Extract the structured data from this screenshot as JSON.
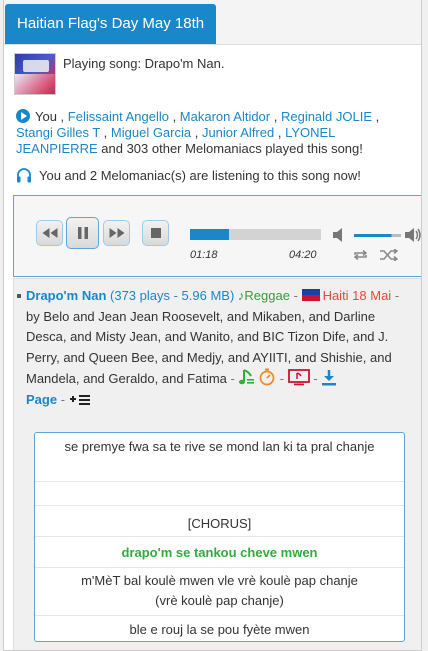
{
  "header": {
    "title": "Haitian Flag's Day May 18th"
  },
  "now_playing": {
    "text": "Playing song: Drapo'm Nan."
  },
  "played": {
    "you": "You",
    "names": [
      "Felissaint Angello",
      "Makaron Altidor",
      "Reginald JOLIE",
      "Stangi Gilles T",
      "Miguel Garcia",
      "Junior Alfred",
      "LYONEL JEANPIERRE"
    ],
    "suffix": "and 303 other Melomaniacs played this song!"
  },
  "listening": {
    "text": "You and 2 Melomaniac(s) are listening to this song now!"
  },
  "player": {
    "elapsed": "01:18",
    "duration": "04:20",
    "progress_fraction": 0.3,
    "volume_fraction": 0.8,
    "icons": [
      "rewind-icon",
      "pause-icon",
      "fast-forward-icon",
      "stop-icon",
      "volume-mute-icon",
      "volume-max-icon",
      "repeat-icon",
      "shuffle-icon"
    ]
  },
  "track": {
    "title": "Drapo'm Nan",
    "stats": "(373 plays - 5.96 MB)",
    "genre": "Reggae",
    "dash": "-",
    "album": "Haiti 18 Mai",
    "credits": "by Belo and Jean Jean Roosevelt, and Mikaben, and Darline Desca, and Misty Jean, and Wanito, and BIC Tizon Dife, and J. Perry, and Queen Bee, and Medjy, and AYIITI, and Shishie, and Mandela, and Geraldo, and Fatima",
    "page_label": "Page"
  },
  "lyrics": [
    "se premye fwa sa te rive se mond lan ki ta pral chanje",
    "[CHORUS]",
    "drapo'm se tankou cheve mwen",
    "m'MèT bal koulè mwen vle vrè koulè pap chanje",
    "(vrè koulè pap chanje)",
    "ble e rouj la se pou fyète mwen"
  ],
  "colors": {
    "accent": "#1a87c8",
    "green": "#2fae3a",
    "red": "#e8483c"
  }
}
